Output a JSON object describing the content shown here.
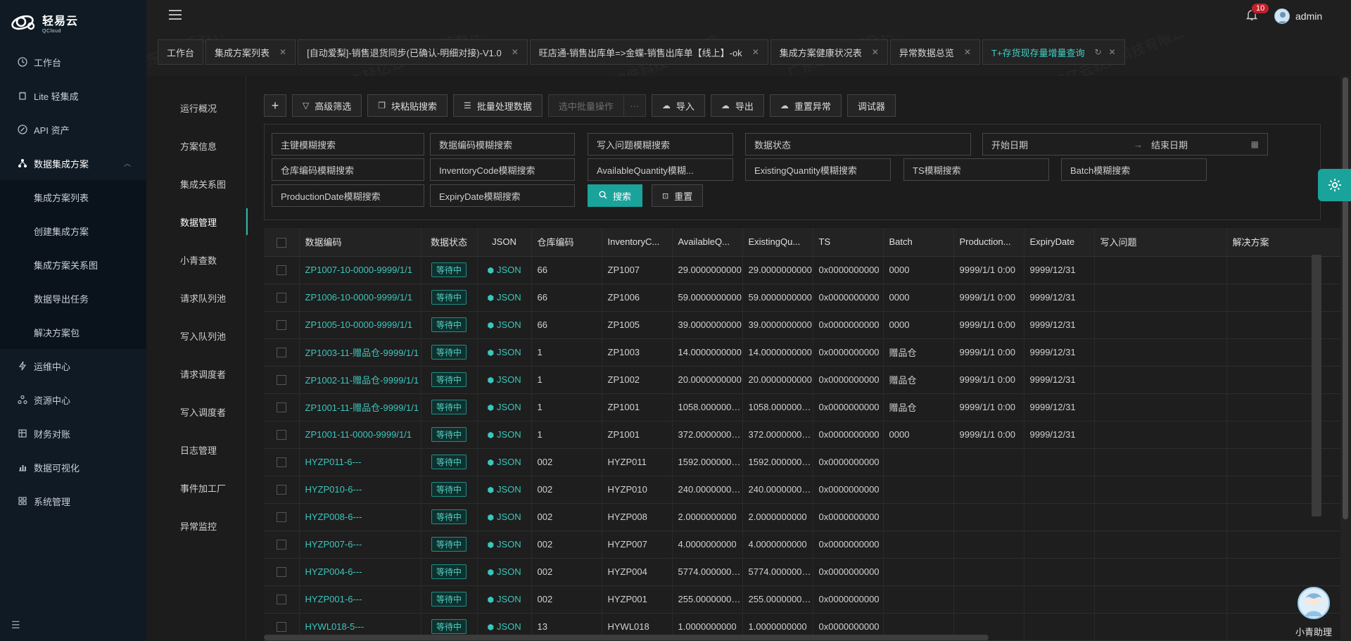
{
  "app": {
    "logo_cn": "轻易云",
    "logo_en": "QCloud"
  },
  "sidebar": {
    "items": [
      {
        "label": "工作台",
        "icon": "clock-icon"
      },
      {
        "label": "Lite 轻集成",
        "icon": "lite-icon"
      },
      {
        "label": "API 资产",
        "icon": "api-icon"
      },
      {
        "label": "数据集成方案",
        "icon": "cluster-icon"
      },
      {
        "label": "运维中心",
        "icon": "bolt-icon"
      },
      {
        "label": "资源中心",
        "icon": "resource-icon"
      },
      {
        "label": "财务对账",
        "icon": "ledger-icon"
      },
      {
        "label": "数据可视化",
        "icon": "chart-icon"
      },
      {
        "label": "系统管理",
        "icon": "system-icon"
      }
    ],
    "sub_items": [
      "集成方案列表",
      "创建集成方案",
      "集成方案关系图",
      "数据导出任务",
      "解决方案包"
    ]
  },
  "topbar": {
    "notification_count": "10",
    "username": "admin"
  },
  "tabs": [
    {
      "label": "工作台",
      "closable": false
    },
    {
      "label": "集成方案列表",
      "closable": true
    },
    {
      "label": "[自动爱梨]-销售退货同步(已确认-明细对接)-V1.0",
      "closable": true
    },
    {
      "label": "旺店通-销售出库单=>金蝶-销售出库单【线上】-ok",
      "closable": true
    },
    {
      "label": "集成方案健康状况表",
      "closable": true
    },
    {
      "label": "异常数据总览",
      "closable": true
    },
    {
      "label": "T+存货现存量增量查询",
      "closable": true,
      "active": true
    }
  ],
  "subnav": [
    "运行概况",
    "方案信息",
    "集成关系图",
    "数据管理",
    "小青查数",
    "请求队列池",
    "写入队列池",
    "请求调度者",
    "写入调度者",
    "日志管理",
    "事件加工厂",
    "异常监控"
  ],
  "toolbar": {
    "add": "+",
    "advanced_filter": "高级筛选",
    "paste_search": "块粘贴搜索",
    "batch_process": "批量处理数据",
    "selected_batch": "选中批量操作",
    "more": "···",
    "import": "导入",
    "export": "导出",
    "reset_error": "重置异常",
    "debugger": "调试器"
  },
  "filters": {
    "pk_search": "主键模糊搜索",
    "code_search": "数据编码模糊搜索",
    "write_issue_search": "写入问题模糊搜索",
    "data_status": "数据状态",
    "start_date": "开始日期",
    "date_arrow": "→",
    "end_date": "结束日期",
    "warehouse_search": "仓库编码模糊搜索",
    "inventory_search": "InventoryCode模糊搜索",
    "available_search": "AvailableQuantity模糊...",
    "existing_search": "ExistingQuantity模糊搜索",
    "ts_search": "TS模糊搜索",
    "batch_search": "Batch模糊搜索",
    "production_search": "ProductionDate模糊搜索",
    "expiry_search": "ExpiryDate模糊搜索",
    "search_button": "搜索",
    "reset_button": "重置"
  },
  "table": {
    "columns": [
      "数据编码",
      "数据状态",
      "JSON",
      "仓库编码",
      "InventoryC...",
      "AvailableQ...",
      "ExistingQu...",
      "TS",
      "Batch",
      "Production...",
      "ExpiryDate",
      "写入问题",
      "解决方案"
    ],
    "rows": [
      {
        "code": "ZP1007-10-0000-9999/1/1",
        "status": "等待中",
        "json": "JSON",
        "warehouse": "66",
        "inventory": "ZP1007",
        "available": "29.0000000000",
        "existing": "29.0000000000",
        "ts": "0x0000000000",
        "batch": "0000",
        "production": "9999/1/1 0:00",
        "expiry": "9999/12/31",
        "issue": "",
        "solution": ""
      },
      {
        "code": "ZP1006-10-0000-9999/1/1",
        "status": "等待中",
        "json": "JSON",
        "warehouse": "66",
        "inventory": "ZP1006",
        "available": "59.0000000000",
        "existing": "59.0000000000",
        "ts": "0x0000000000",
        "batch": "0000",
        "production": "9999/1/1 0:00",
        "expiry": "9999/12/31",
        "issue": "",
        "solution": ""
      },
      {
        "code": "ZP1005-10-0000-9999/1/1",
        "status": "等待中",
        "json": "JSON",
        "warehouse": "66",
        "inventory": "ZP1005",
        "available": "39.0000000000",
        "existing": "39.0000000000",
        "ts": "0x0000000000",
        "batch": "0000",
        "production": "9999/1/1 0:00",
        "expiry": "9999/12/31",
        "issue": "",
        "solution": ""
      },
      {
        "code": "ZP1003-11-赠品仓-9999/1/1",
        "status": "等待中",
        "json": "JSON",
        "warehouse": "1",
        "inventory": "ZP1003",
        "available": "14.0000000000",
        "existing": "14.0000000000",
        "ts": "0x0000000000",
        "batch": "赠品仓",
        "production": "9999/1/1 0:00",
        "expiry": "9999/12/31",
        "issue": "",
        "solution": ""
      },
      {
        "code": "ZP1002-11-赠品仓-9999/1/1",
        "status": "等待中",
        "json": "JSON",
        "warehouse": "1",
        "inventory": "ZP1002",
        "available": "20.0000000000",
        "existing": "20.0000000000",
        "ts": "0x0000000000",
        "batch": "赠品仓",
        "production": "9999/1/1 0:00",
        "expiry": "9999/12/31",
        "issue": "",
        "solution": ""
      },
      {
        "code": "ZP1001-11-赠品仓-9999/1/1",
        "status": "等待中",
        "json": "JSON",
        "warehouse": "1",
        "inventory": "ZP1001",
        "available": "1058.000000000",
        "existing": "1058.000000000",
        "ts": "0x0000000000",
        "batch": "赠品仓",
        "production": "9999/1/1 0:00",
        "expiry": "9999/12/31",
        "issue": "",
        "solution": ""
      },
      {
        "code": "ZP1001-11-0000-9999/1/1",
        "status": "等待中",
        "json": "JSON",
        "warehouse": "1",
        "inventory": "ZP1001",
        "available": "372.0000000000",
        "existing": "372.0000000000",
        "ts": "0x0000000000",
        "batch": "0000",
        "production": "9999/1/1 0:00",
        "expiry": "9999/12/31",
        "issue": "",
        "solution": ""
      },
      {
        "code": "HYZP011-6---",
        "status": "等待中",
        "json": "JSON",
        "warehouse": "002",
        "inventory": "HYZP011",
        "available": "1592.000000000",
        "existing": "1592.000000000",
        "ts": "0x0000000000",
        "batch": "",
        "production": "",
        "expiry": "",
        "issue": "",
        "solution": ""
      },
      {
        "code": "HYZP010-6---",
        "status": "等待中",
        "json": "JSON",
        "warehouse": "002",
        "inventory": "HYZP010",
        "available": "240.0000000000",
        "existing": "240.0000000000",
        "ts": "0x0000000000",
        "batch": "",
        "production": "",
        "expiry": "",
        "issue": "",
        "solution": ""
      },
      {
        "code": "HYZP008-6---",
        "status": "等待中",
        "json": "JSON",
        "warehouse": "002",
        "inventory": "HYZP008",
        "available": "2.0000000000",
        "existing": "2.0000000000",
        "ts": "0x0000000000",
        "batch": "",
        "production": "",
        "expiry": "",
        "issue": "",
        "solution": ""
      },
      {
        "code": "HYZP007-6---",
        "status": "等待中",
        "json": "JSON",
        "warehouse": "002",
        "inventory": "HYZP007",
        "available": "4.0000000000",
        "existing": "4.0000000000",
        "ts": "0x0000000000",
        "batch": "",
        "production": "",
        "expiry": "",
        "issue": "",
        "solution": ""
      },
      {
        "code": "HYZP004-6---",
        "status": "等待中",
        "json": "JSON",
        "warehouse": "002",
        "inventory": "HYZP004",
        "available": "5774.000000000",
        "existing": "5774.000000000",
        "ts": "0x0000000000",
        "batch": "",
        "production": "",
        "expiry": "",
        "issue": "",
        "solution": ""
      },
      {
        "code": "HYZP001-6---",
        "status": "等待中",
        "json": "JSON",
        "warehouse": "002",
        "inventory": "HYZP001",
        "available": "255.0000000000",
        "existing": "255.0000000000",
        "ts": "0x0000000000",
        "batch": "",
        "production": "",
        "expiry": "",
        "issue": "",
        "solution": ""
      },
      {
        "code": "HYWL018-5---",
        "status": "等待中",
        "json": "JSON",
        "warehouse": "13",
        "inventory": "HYWL018",
        "available": "1.0000000000",
        "existing": "1.0000000000",
        "ts": "0x0000000000",
        "batch": "",
        "production": "",
        "expiry": "",
        "issue": "",
        "solution": ""
      }
    ]
  },
  "assistant": {
    "label": "小青助理"
  },
  "watermark": "广东轻亿云软件科技有限公司",
  "colors": {
    "accent": "#1aa39b",
    "link": "#3cc6bb",
    "sidebar_bg": "#0f1a24",
    "badge": "#c0202a"
  }
}
